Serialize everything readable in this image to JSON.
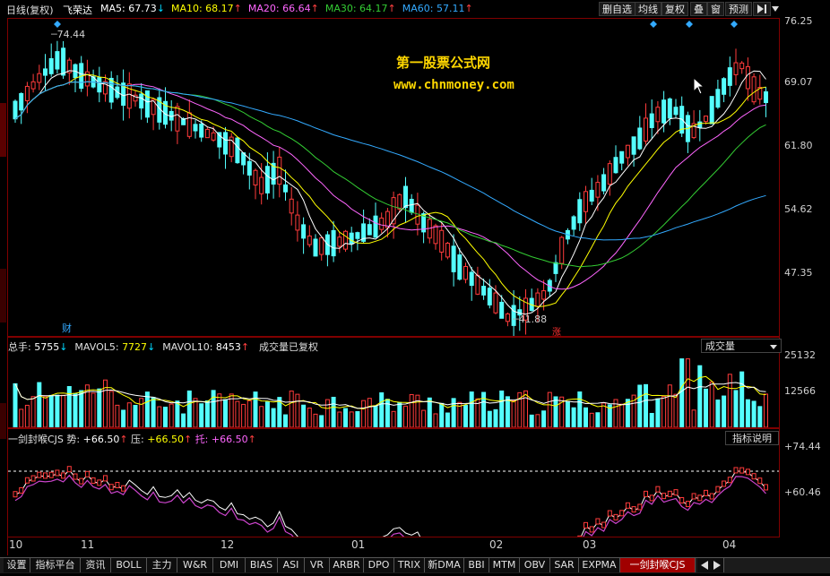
{
  "header": {
    "period": "日线(复权)",
    "stock_name": "飞荣达",
    "ma": [
      {
        "label": "MA5:",
        "value": "67.73",
        "arrow": "↓",
        "color": "#ffffff",
        "arrow_color": "#00d8ff"
      },
      {
        "label": "MA10:",
        "value": "68.17",
        "arrow": "↑",
        "color": "#ffff00",
        "arrow_color": "#ff4040"
      },
      {
        "label": "MA20:",
        "value": "66.64",
        "arrow": "↑",
        "color": "#ff66ff",
        "arrow_color": "#ff4040"
      },
      {
        "label": "MA30:",
        "value": "64.17",
        "arrow": "↑",
        "color": "#33cc33",
        "arrow_color": "#ff4040"
      },
      {
        "label": "MA60:",
        "value": "57.11",
        "arrow": "↑",
        "color": "#33aaff",
        "arrow_color": "#ff4040"
      }
    ],
    "buttons": [
      "删自选",
      "均线",
      "复权",
      "叠",
      "窗",
      "预测"
    ],
    "play_icon": "play-icon",
    "close_icon": "close-icon"
  },
  "watermark": {
    "title": "第一股票公式网",
    "url": "www.chnmoney.com"
  },
  "price_panel": {
    "y_labels": [
      "76.25",
      "69.07",
      "61.80",
      "54.62",
      "47.35"
    ],
    "high_marker": "74.44",
    "low_marker": "41.88",
    "cai_marker": "财",
    "zhang_marker": "涨"
  },
  "volume_panel": {
    "items": [
      {
        "label": "总手: ",
        "value": "5755",
        "arrow": "↓",
        "color": "#ffffff",
        "arrow_color": "#00d8ff"
      },
      {
        "label": "MAVOL5: ",
        "value": "7727",
        "arrow": "↓",
        "color": "#ffff00",
        "arrow_color": "#00d8ff"
      },
      {
        "label": "MAVOL10: ",
        "value": "8453",
        "arrow": "↑",
        "color": "#ffffff",
        "arrow_color": "#ff4040"
      }
    ],
    "note": "成交量已复权",
    "dropdown": "成交量",
    "y_labels": [
      "25132",
      "12566"
    ]
  },
  "indicator_panel": {
    "name": "一剑封喉CJS 势: ",
    "shi_value": "+66.50",
    "ya_label": "压: ",
    "ya_value": "+66.50",
    "tuo_label": "托: ",
    "tuo_value": "+66.50",
    "help_button": "指标说明",
    "y_labels": [
      "+74.44",
      "+60.46"
    ]
  },
  "x_labels": [
    "10",
    "11",
    "12",
    "01",
    "02",
    "03",
    "04"
  ],
  "bottom_tabs": [
    "设置",
    "指标平台",
    "资讯",
    "BOLL",
    "主力",
    "W&R",
    "DMI",
    "BIAS",
    "ASI",
    "VR",
    "ARBR",
    "DPO",
    "TRIX",
    "新DMA",
    "BBI",
    "MTM",
    "OBV",
    "SAR",
    "EXPMA",
    "一剑封喉CJS"
  ],
  "active_tab": "一剑封喉CJS",
  "chart_data": {
    "type": "candlestick",
    "y_range": [
      41.0,
      77.0
    ],
    "ma_values": {
      "MA5": 67.73,
      "MA10": 68.17,
      "MA20": 66.64,
      "MA30": 64.17,
      "MA60": 57.11
    },
    "high": 74.44,
    "low": 41.88,
    "volume_ticks": [
      12566,
      25132
    ],
    "indicator_ticks": [
      60.46,
      74.44
    ],
    "x_months": [
      "10",
      "11",
      "12",
      "01",
      "02",
      "03",
      "04"
    ]
  }
}
